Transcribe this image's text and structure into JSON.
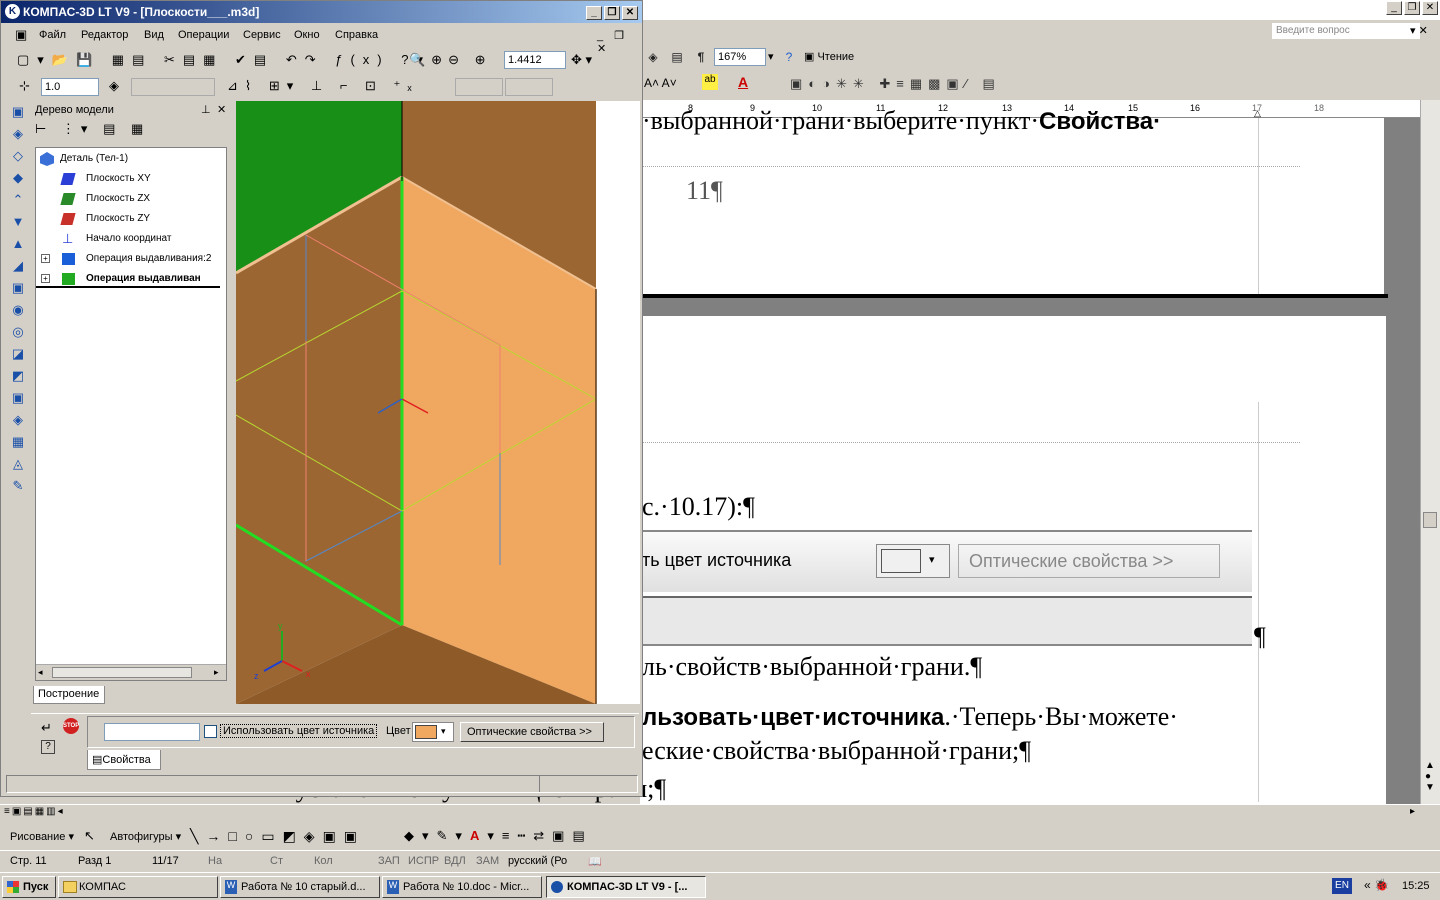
{
  "word": {
    "help_placeholder": "Введите вопрос",
    "zoom": "167%",
    "reading_label": "Чтение",
    "ruler_numbers": [
      "8",
      "9",
      "10",
      "11",
      "12",
      "13",
      "14",
      "15",
      "16",
      "17",
      "18"
    ],
    "text_line1": "·выбранной·грани·выберите·пункт·",
    "text_line1_bold": "Свойства·",
    "page_number": "11¶",
    "text_ref": "с.·10.17):¶",
    "panel_label_color": "Цвет",
    "panel_use_source": "ть цвет источника",
    "panel_optical": "Оптические свойства  >>",
    "pilcrow": "¶",
    "text_line2": "ль·свойств·выбранной·грани.¶",
    "text_line3_bold": "льзовать·цвет·источника",
    "text_line3": ".·Теперь·Вы·можете·",
    "text_line4": "еские·свойства·выбранной·грани;¶",
    "text_line5": "установите·нужный·цвет·грани;¶"
  },
  "drawing_bar": {
    "draw_label": "Рисование ▾",
    "autoshapes_label": "Автофигуры ▾"
  },
  "status": {
    "page": "Стр. 11",
    "section": "Разд 1",
    "pages": "11/17",
    "at": "На",
    "line": "Ст",
    "col": "Кол",
    "rec": "ЗАП",
    "trk": "ИСПР",
    "ext": "ВДЛ",
    "ovr": "ЗАМ",
    "lang": "русский (Ро"
  },
  "taskbar": {
    "start": "Пуск",
    "tasks": [
      "КОМПАС",
      "Работа № 10 старый.d...",
      "Работа № 10.doc - Micr...",
      "КОМПАС-3D LT V9 - [..."
    ],
    "lang": "EN",
    "time": "15:25"
  },
  "kompas": {
    "title": "КОМПАС-3D LT V9 - [Плоскости___.m3d]",
    "menu": [
      "Файл",
      "Редактор",
      "Вид",
      "Операции",
      "Сервис",
      "Окно",
      "Справка"
    ],
    "scale_value": "1.4412",
    "step_value": "1.0",
    "tree_title": "Дерево модели",
    "tree_items": [
      {
        "label": "Деталь (Тел-1)",
        "bold": false,
        "color": "#3a6fd8"
      },
      {
        "label": "Плоскость XY",
        "bold": false,
        "color": "#2b3fd6"
      },
      {
        "label": "Плоскость ZX",
        "bold": false,
        "color": "#2a8a2a"
      },
      {
        "label": "Плоскость ZY",
        "bold": false,
        "color": "#c8302a"
      },
      {
        "label": "Начало координат",
        "bold": false,
        "color": "#2b3fd6"
      },
      {
        "label": "Операция выдавливания:2",
        "bold": false,
        "color": "#1a5ed8"
      },
      {
        "label": "Операция выдавливан",
        "bold": true,
        "color": "#22aa22"
      }
    ],
    "tab_build": "Построение",
    "use_source_color": "Использовать цвет источника",
    "color_label": "Цвет",
    "optical_props": "Оптические свойства  >>",
    "tab_props": "Свойства",
    "face_color": "#f0a860"
  }
}
